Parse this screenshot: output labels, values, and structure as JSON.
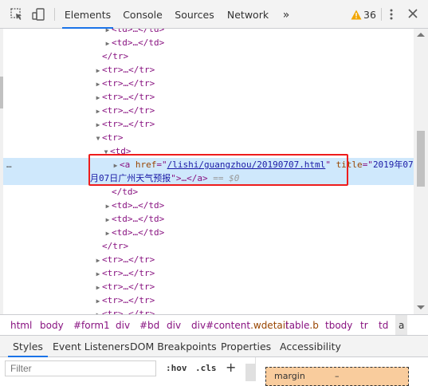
{
  "toolbar": {
    "tabs": [
      "Elements",
      "Console",
      "Sources",
      "Network"
    ],
    "more_tabs": "»",
    "warning_count": "36",
    "close": "✕"
  },
  "tree": {
    "td_collapsed": "<td>…</td>",
    "tr_collapsed": "<tr>…</tr>",
    "tr_open": "<tr>",
    "tr_close": "</tr>",
    "td_open": "<td>",
    "td_close": "</td>",
    "selected": {
      "tag_open": "<a",
      "href_attr": "href",
      "href_value": "/lishi/guangzhou/20190707.html",
      "title_attr": "title",
      "title_value_part1": "2019年07",
      "title_value_part2": "月07日广州天气预报",
      "tail": "…</a>",
      "console_ref": "== $0",
      "gutter_dots": "…"
    }
  },
  "breadcrumbs": {
    "items": [
      "html",
      "body",
      "#form1",
      "div",
      "#bd",
      "div"
    ],
    "content_tag": "div",
    "content_id": "#content",
    "content_class": ".wdetail",
    "table_tag": "table",
    "table_class": ".b",
    "tail_items": [
      "tbody",
      "tr",
      "td"
    ],
    "current": "a"
  },
  "styles_tabs": [
    "Styles",
    "Event Listeners",
    "DOM Breakpoints",
    "Properties",
    "Accessibility"
  ],
  "filter": {
    "placeholder": "Filter",
    "hov": ":hov",
    "cls": ".cls",
    "plus": "+"
  },
  "box_model": {
    "label": "margin",
    "value": "–"
  }
}
